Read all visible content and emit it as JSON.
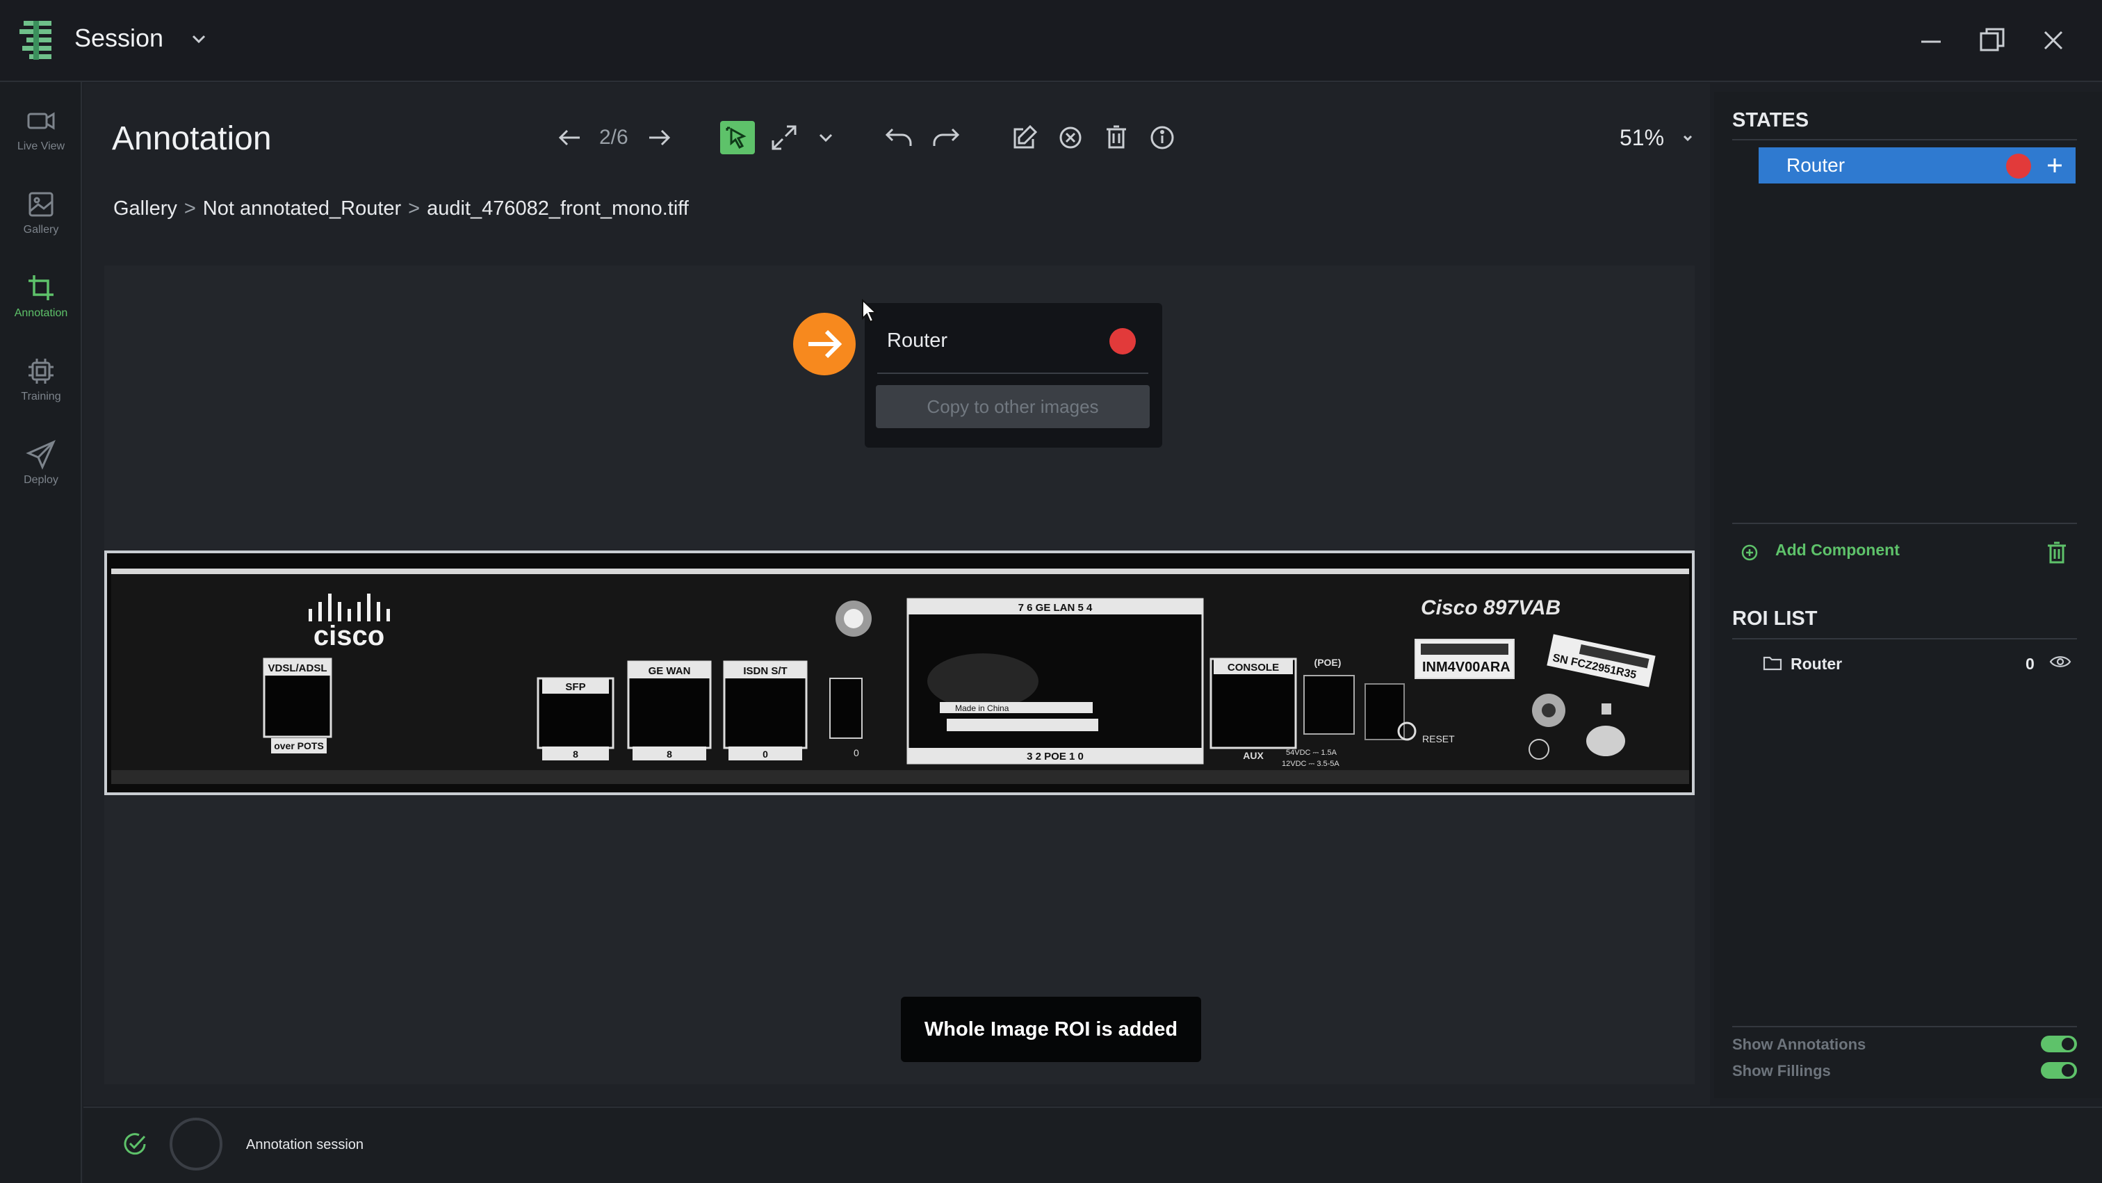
{
  "app": {
    "title": "Session"
  },
  "nav": {
    "items": [
      {
        "label": "Live View",
        "icon": "video-camera-icon"
      },
      {
        "label": "Gallery",
        "icon": "image-icon"
      },
      {
        "label": "Annotation",
        "icon": "crop-icon",
        "active": true
      },
      {
        "label": "Training",
        "icon": "chip-icon"
      },
      {
        "label": "Deploy",
        "icon": "send-icon"
      }
    ]
  },
  "header": {
    "title": "Annotation",
    "page_count": "2/6",
    "zoom": "51%"
  },
  "breadcrumb": {
    "items": [
      "Gallery",
      "Not annotated_Router",
      "audit_476082_front_mono.tiff"
    ],
    "separator": ">"
  },
  "popup": {
    "label": "Router",
    "dot_color": "#e23a3a",
    "copy_button": "Copy to other images"
  },
  "image": {
    "brand": "cisco",
    "model": "Cisco 897VAB",
    "ports": [
      {
        "top": "VDSL/ADSL",
        "bottom": "over POTS"
      },
      {
        "top": "SFP",
        "bottom": "8"
      },
      {
        "top": "GE WAN",
        "bottom": "8"
      },
      {
        "top": "ISDN S/T",
        "bottom": "0"
      },
      {
        "top": "",
        "bottom": "0"
      },
      {
        "top": "7   6   GE LAN   5   4",
        "bottom": "3   2   POE   1   0"
      },
      {
        "top": "CONSOLE",
        "bottom": "AUX"
      },
      {
        "top": "(POE)",
        "bottom": ""
      }
    ],
    "power_top": "54VDC ⎓ 1.5A",
    "power_bottom": "12VDC ⎓ 3.5-5A",
    "reset": "RESET",
    "label_serial": "INM4V00ARA",
    "label_sn": "SN FCZ2951R35",
    "china_label": "Made in China"
  },
  "toast": {
    "text": "Whole Image ROI is added"
  },
  "states": {
    "title": "STATES",
    "items": [
      {
        "label": "Router",
        "color": "#e23a3a"
      }
    ],
    "add_component": "Add Component"
  },
  "roi": {
    "title": "ROI LIST",
    "items": [
      {
        "label": "Router",
        "count": "0"
      }
    ]
  },
  "options": {
    "show_annotations": "Show Annotations",
    "show_fillings": "Show Fillings"
  },
  "status": {
    "text": "Annotation session"
  },
  "colors": {
    "accent": "#5ec26a",
    "selection": "#2f7ad0",
    "orange": "#f7891e"
  }
}
